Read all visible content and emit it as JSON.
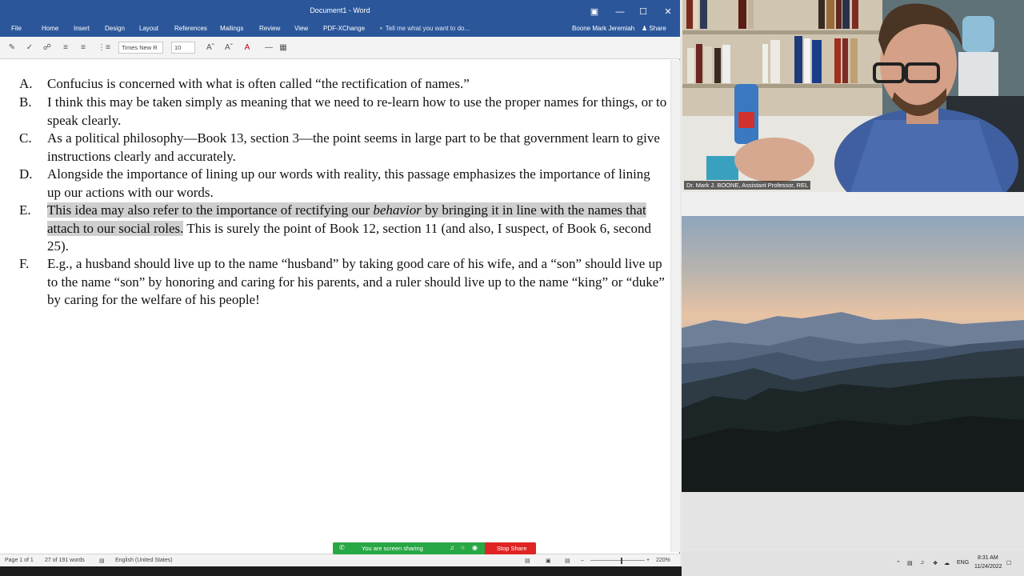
{
  "word": {
    "title": "Document1 - Word",
    "tabs": [
      "File",
      "Home",
      "Insert",
      "Design",
      "Layout",
      "References",
      "Mailings",
      "Review",
      "View",
      "PDF-XChange"
    ],
    "tell_me": "Tell me what you want to do...",
    "user": "Boone Mark Jeremiah",
    "share": "Share",
    "font_name": "Times New R",
    "font_size": "10",
    "paragraphs": [
      {
        "letter": "A.",
        "text": "Confucius is concerned with what is often called “the rectification of names.”"
      },
      {
        "letter": "B.",
        "text": "I think this may be taken simply as meaning that we need to re-learn how to use the proper names for things, or to speak clearly."
      },
      {
        "letter": "C.",
        "text": "As a political philosophy—Book 13, section 3—the point seems in large part to be that government learn to give instructions clearly and accurately."
      },
      {
        "letter": "D.",
        "text": "Alongside the importance of lining up our words with reality, this passage emphasizes the importance of lining up our actions with our words."
      },
      {
        "letter": "E.",
        "hl_before": "This idea may also refer to the importance of rectifying our ",
        "hl_italic": "behavior",
        "hl_after": " by bringing it in line with the names that attach to our social roles.",
        "rest": " This is surely the point of Book 12, section 11 (and also, I suspect, of Book 6, second 25)."
      },
      {
        "letter": "F.",
        "text": "E.g., a husband should live up to the name “husband” by taking good care of his wife, and a “son” should live up to the name “son” by honoring and caring for his parents, and a ruler should live up to the name “king” or “duke” by caring for the welfare of his people!"
      }
    ],
    "status": {
      "page": "Page 1 of 1",
      "words": "27 of 191 words",
      "language": "English (United States)",
      "zoom": "220%"
    }
  },
  "screen_share": {
    "message": "You are screen sharing",
    "stop": "Stop Share"
  },
  "webcam": {
    "caption": "Dr. Mark J. BOONE, Assistant Professor, REL"
  },
  "system": {
    "lang": "ENG",
    "time": "8:31 AM",
    "date": "11/24/2022"
  },
  "colors": {
    "word_blue": "#2b579a",
    "share_green": "#28a745",
    "stop_red": "#e02424",
    "highlight": "#cfcfcf"
  }
}
